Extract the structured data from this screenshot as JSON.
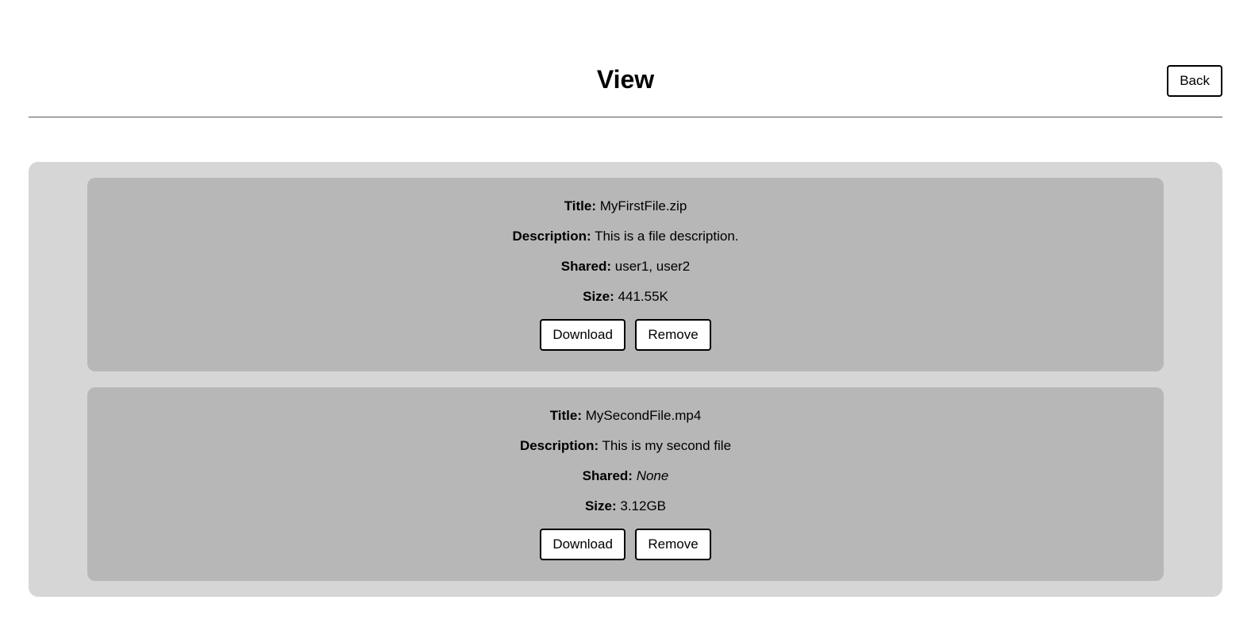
{
  "header": {
    "back_label": "Back",
    "title": "View"
  },
  "labels": {
    "title": "Title:",
    "description": "Description:",
    "shared": "Shared:",
    "size": "Size:",
    "download": "Download",
    "remove": "Remove",
    "none": "None"
  },
  "files": [
    {
      "title": "MyFirstFile.zip",
      "description": "This is a file description.",
      "shared": "user1, user2",
      "shared_none": false,
      "size": "441.55K"
    },
    {
      "title": "MySecondFile.mp4",
      "description": "This is my second file",
      "shared": "None",
      "shared_none": true,
      "size": "3.12GB"
    }
  ]
}
